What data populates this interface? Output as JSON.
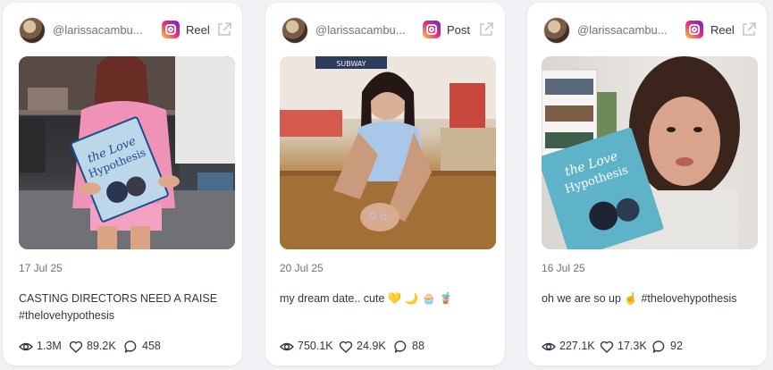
{
  "cards": [
    {
      "handle": "@larissacambu...",
      "type": "Reel",
      "date": "17 Jul 25",
      "caption": "CASTING DIRECTORS NEED A RAISE #thelovehypothesis",
      "views": "1.3M",
      "likes": "89.2K",
      "comments": "458",
      "book_title_top": "the Love",
      "book_title_bottom": "Hypothesis"
    },
    {
      "handle": "@larissacambu...",
      "type": "Post",
      "date": "20 Jul 25",
      "caption": "my dream date.. cute 💛 🌙 🧁 🧋",
      "views": "750.1K",
      "likes": "24.9K",
      "comments": "88",
      "storefront_sign": "SUBWAY"
    },
    {
      "handle": "@larissacambu...",
      "type": "Reel",
      "date": "16 Jul 25",
      "caption": "oh we are so up ☝️ #thelovehypothesis",
      "views": "227.1K",
      "likes": "17.3K",
      "comments": "92",
      "book_title_top": "the Love",
      "book_title_bottom": "Hypothesis"
    }
  ],
  "icons": {
    "platform": "instagram-icon",
    "external": "external-link-icon",
    "views": "eye-icon",
    "likes": "heart-icon",
    "comments": "comment-icon"
  },
  "colors": {
    "page_bg": "#f1f2f5",
    "card_bg": "#ffffff",
    "text": "#2f3542",
    "muted": "#6b7280"
  }
}
